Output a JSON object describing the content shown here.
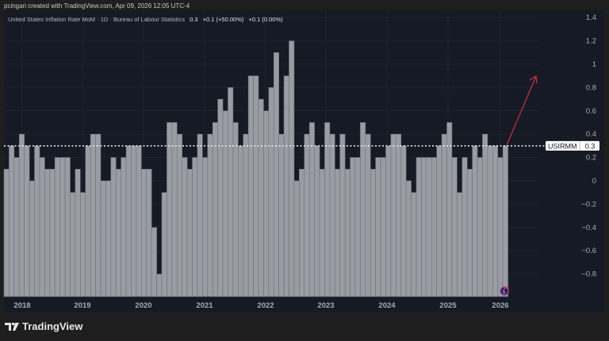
{
  "credit": "pcingari created with TradingView.com, Apr 09, 2026 12:05 UTC-4",
  "legend": {
    "title": "United States Inflation Rate MoM · 1D · Bureau of Labour Statistics",
    "last": "0.3",
    "change": "+0.1 (+50.00%)",
    "change2": "+0.1 (0.00%)"
  },
  "price_label": {
    "symbol": "USIRMM",
    "value": "0.3"
  },
  "logo": "TradingView",
  "colors": {
    "bar": "#9a9ca3",
    "background": "#161a25",
    "arrow": "#d32f3f"
  },
  "chart_data": {
    "type": "bar",
    "title": "United States Inflation Rate MoM",
    "ylim": [
      -1.0,
      1.45
    ],
    "y_ticks": [
      1.4,
      1.2,
      1,
      0.8,
      0.6,
      0.4,
      0.2,
      0,
      -0.2,
      -0.4,
      -0.6,
      -0.8
    ],
    "x_ticks": [
      "2018",
      "2019",
      "2020",
      "2021",
      "2022",
      "2023",
      "2024",
      "2025",
      "2026"
    ],
    "reference_line": 0.3,
    "values": [
      0.1,
      0.3,
      0.2,
      0.4,
      0.3,
      0.0,
      0.3,
      0.2,
      0.1,
      0.1,
      0.2,
      0.2,
      0.2,
      -0.1,
      0.1,
      -0.1,
      0.3,
      0.4,
      0.4,
      0.0,
      0.0,
      0.2,
      0.1,
      0.2,
      0.3,
      0.3,
      0.3,
      0.1,
      0.1,
      -0.4,
      -0.8,
      -0.1,
      0.5,
      0.5,
      0.4,
      0.2,
      0.1,
      0.2,
      0.4,
      0.2,
      0.4,
      0.5,
      0.7,
      0.6,
      0.8,
      0.5,
      0.3,
      0.4,
      0.9,
      0.9,
      0.7,
      0.6,
      0.8,
      1.1,
      0.4,
      0.9,
      1.2,
      0.0,
      0.1,
      0.4,
      0.5,
      0.3,
      0.1,
      0.5,
      0.4,
      0.1,
      0.4,
      0.1,
      0.2,
      0.2,
      0.5,
      0.4,
      0.1,
      0.2,
      0.2,
      0.3,
      0.4,
      0.4,
      0.3,
      0.0,
      -0.1,
      0.2,
      0.2,
      0.2,
      0.2,
      0.3,
      0.4,
      0.5,
      0.2,
      -0.1,
      0.2,
      0.1,
      0.3,
      0.2,
      0.4,
      0.3,
      0.3,
      0.2,
      0.3
    ]
  }
}
